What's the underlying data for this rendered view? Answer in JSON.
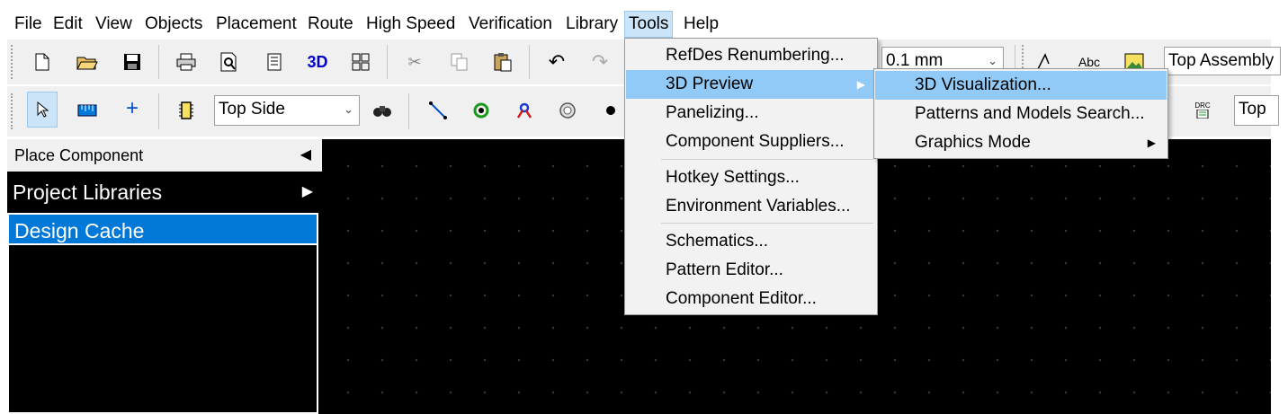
{
  "menubar": {
    "items": [
      "File",
      "Edit",
      "View",
      "Objects",
      "Placement",
      "Route",
      "High Speed",
      "Verification",
      "Library",
      "Tools",
      "Help"
    ],
    "active": "Tools"
  },
  "toolbar1": {
    "grid_combo": "0.1 mm",
    "assembly_combo": "Top Assembly",
    "icons": [
      "new-file-icon",
      "open-folder-icon",
      "save-icon",
      "print-icon",
      "print-preview-icon",
      "report-icon",
      "3d-view-icon",
      "grid-view-icon",
      "cut-icon",
      "copy-icon",
      "paste-icon",
      "undo-icon",
      "redo-icon",
      "text-style-icon",
      "abc-text-icon",
      "image-icon"
    ],
    "label_3d": "3D",
    "label_abc": "Abc"
  },
  "toolbar2": {
    "side_combo": "Top Side",
    "right_combo": "Top",
    "icons": [
      "select-arrow-icon",
      "ruler-icon",
      "crosshair-icon",
      "component-icon",
      "find-icon",
      "route-line-icon",
      "via-icon",
      "route-tool-icon",
      "pad-icon",
      "dot-icon",
      "drc-icon"
    ],
    "label_drc": "DRC"
  },
  "left_panel": {
    "header": "Place Component",
    "rows": [
      "Project Libraries",
      "Design Cache"
    ]
  },
  "tools_menu": {
    "groups": [
      [
        "RefDes Renumbering...",
        "3D Preview",
        "Panelizing...",
        "Component Suppliers..."
      ],
      [
        "Hotkey Settings...",
        "Environment Variables..."
      ],
      [
        "Schematics...",
        "Pattern Editor...",
        "Component Editor..."
      ]
    ],
    "highlighted": "3D Preview"
  },
  "submenu_3d": {
    "items": [
      "3D Visualization...",
      "Patterns and Models Search...",
      "Graphics Mode"
    ],
    "highlighted": "3D Visualization..."
  },
  "colors": {
    "highlight": "#91c9f7",
    "selection_blue": "#0078d7",
    "canvas": "#000000",
    "menu_bg": "#f2f2f2"
  }
}
